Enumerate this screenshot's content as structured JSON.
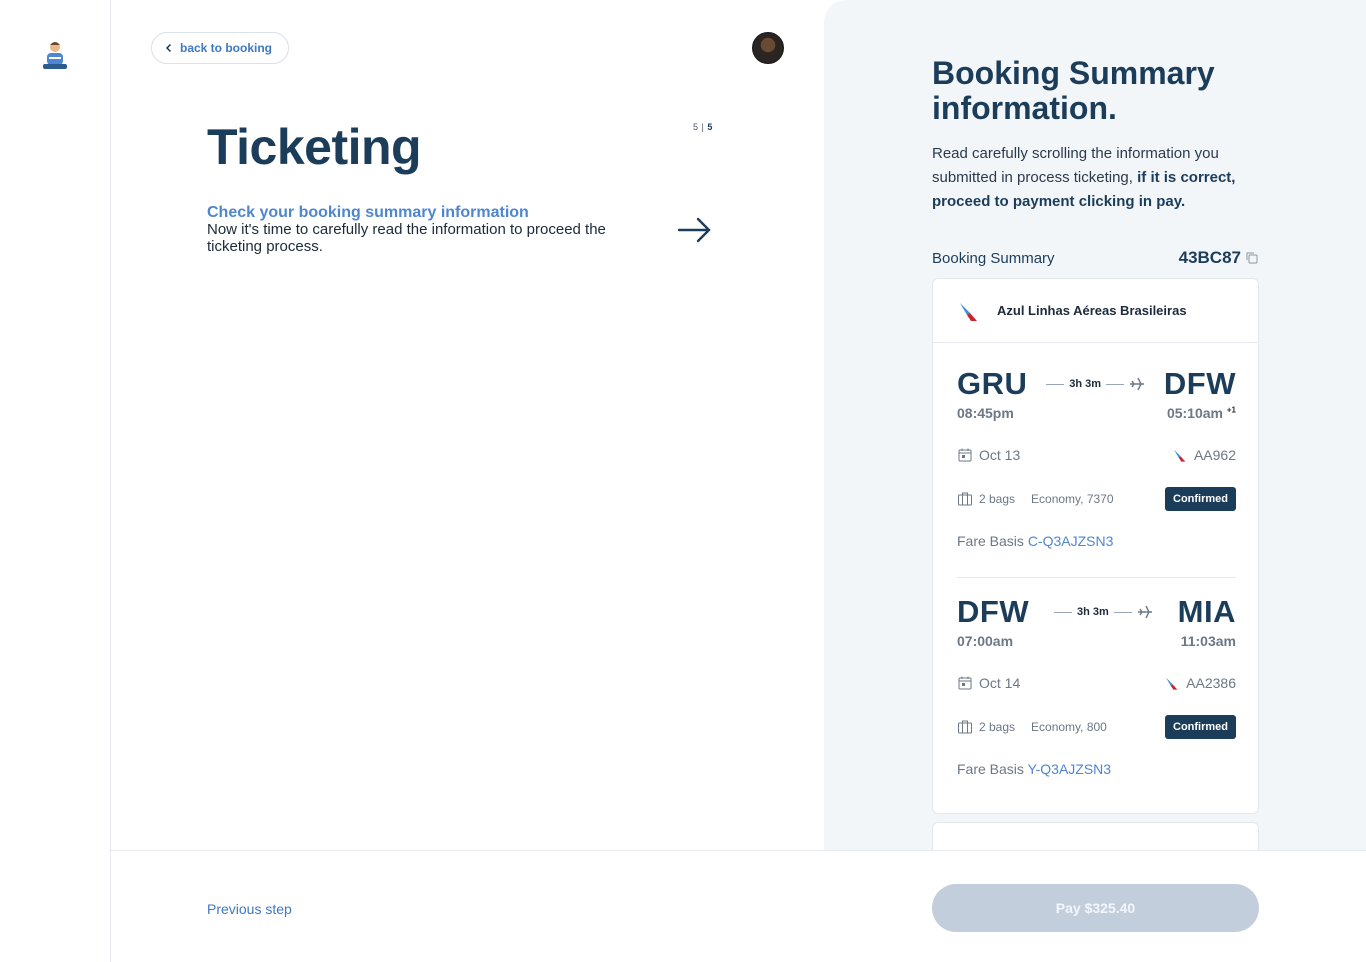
{
  "nav": {
    "back_label": "back to booking",
    "step_current": "5",
    "step_total": "5"
  },
  "main": {
    "title": "Ticketing",
    "intro_heading": "Check your booking summary information",
    "intro_body": "Now it's time to carefully read the information to proceed the ticketing process."
  },
  "summary": {
    "title": "Booking Summary information.",
    "desc_plain": "Read carefully scrolling the information you submitted in process ticketing,",
    "desc_bold": "if it is correct, proceed to payment clicking in pay.",
    "label": "Booking Summary",
    "code": "43BC87",
    "airline": "Azul Linhas Aéreas Brasileiras",
    "segments": [
      {
        "from": "GRU",
        "to": "DFW",
        "duration": "3h 3m",
        "dep": "08:45pm",
        "arr": "05:10am",
        "arr_offset": "+1",
        "date": "Oct 13",
        "flight": "AA962",
        "bags": "2 bags",
        "cabin": "Economy, 7370",
        "status": "Confirmed",
        "fare_label": "Fare Basis",
        "fare": "C-Q3AJZSN3"
      },
      {
        "from": "DFW",
        "to": "MIA",
        "duration": "3h 3m",
        "dep": "07:00am",
        "arr": "11:03am",
        "arr_offset": "",
        "date": "Oct 14",
        "flight": "AA2386",
        "bags": "2 bags",
        "cabin": "Economy, 800",
        "status": "Confirmed",
        "fare_label": "Fare Basis",
        "fare": "Y-Q3AJZSN3"
      }
    ]
  },
  "footer": {
    "prev_label": "Previous step",
    "pay_label": "Pay $325.40"
  },
  "colors": {
    "primary": "#1c3d5a",
    "link": "#3e78c1",
    "panel": "#f3f6f9",
    "pay_disabled": "#c3cedd"
  }
}
